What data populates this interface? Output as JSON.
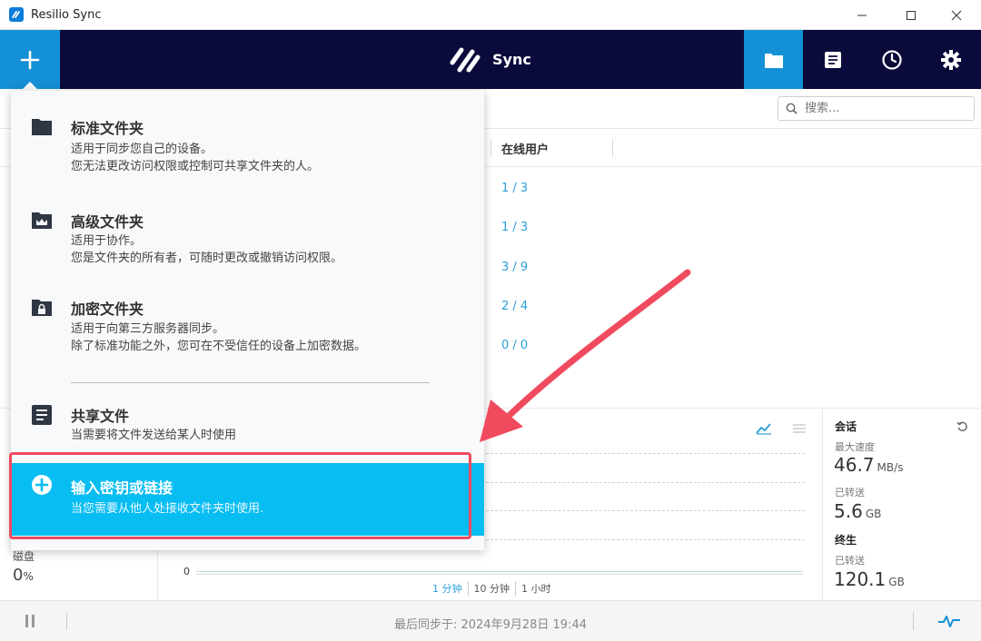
{
  "window": {
    "title": "Resilio Sync"
  },
  "header": {
    "logo_text": "Sync"
  },
  "search": {
    "placeholder": "搜索..."
  },
  "table": {
    "col_online": "在线用户",
    "online_values": [
      "1 / 3",
      "1 / 3",
      "3 / 9",
      "2 / 4",
      "0 / 0"
    ]
  },
  "menu": {
    "items": [
      {
        "title": "标准文件夹",
        "desc1": "适用于同步您自己的设备。",
        "desc2": "您无法更改访问权限或控制可共享文件夹的人。",
        "icon": "folder-icon"
      },
      {
        "title": "高级文件夹",
        "desc1": "适用于协作。",
        "desc2": "您是文件夹的所有者，可随时更改或撤销访问权限。",
        "icon": "crown-folder-icon"
      },
      {
        "title": "加密文件夹",
        "desc1": "适用于向第三方服务器同步。",
        "desc2": "除了标准功能之外，您可在不受信任的设备上加密数据。",
        "icon": "lock-folder-icon"
      },
      {
        "title": "共享文件",
        "desc1": "当需要将文件发送给某人时使用",
        "icon": "document-icon"
      },
      {
        "title": "输入密钥或链接",
        "desc1": "当您需要从他人处接收文件夹时使用.",
        "icon": "plus-circle-icon"
      }
    ]
  },
  "disk": {
    "label": "磁盘",
    "value": "0",
    "unit": "%"
  },
  "chart": {
    "y_zero": "0",
    "ranges": [
      "1 分钟",
      "10 分钟",
      "1 小时"
    ],
    "active_range": 0
  },
  "stats": {
    "session_label": "会话",
    "max_speed_label": "最大速度",
    "max_speed_value": "46.7",
    "max_speed_unit": "MB/s",
    "session_transferred_label": "已转送",
    "session_transferred_value": "5.6",
    "session_transferred_unit": "GB",
    "lifetime_label": "终生",
    "lifetime_transferred_label": "已转送",
    "lifetime_transferred_value": "120.1",
    "lifetime_transferred_unit": "GB"
  },
  "status": {
    "last_sync": "最后同步于:  2024年9月28日 19:44"
  },
  "colors": {
    "header_bg": "#0b0b3b",
    "accent": "#1490d6",
    "highlight_item": "#08bdf2",
    "annotation": "#f04a5e"
  }
}
